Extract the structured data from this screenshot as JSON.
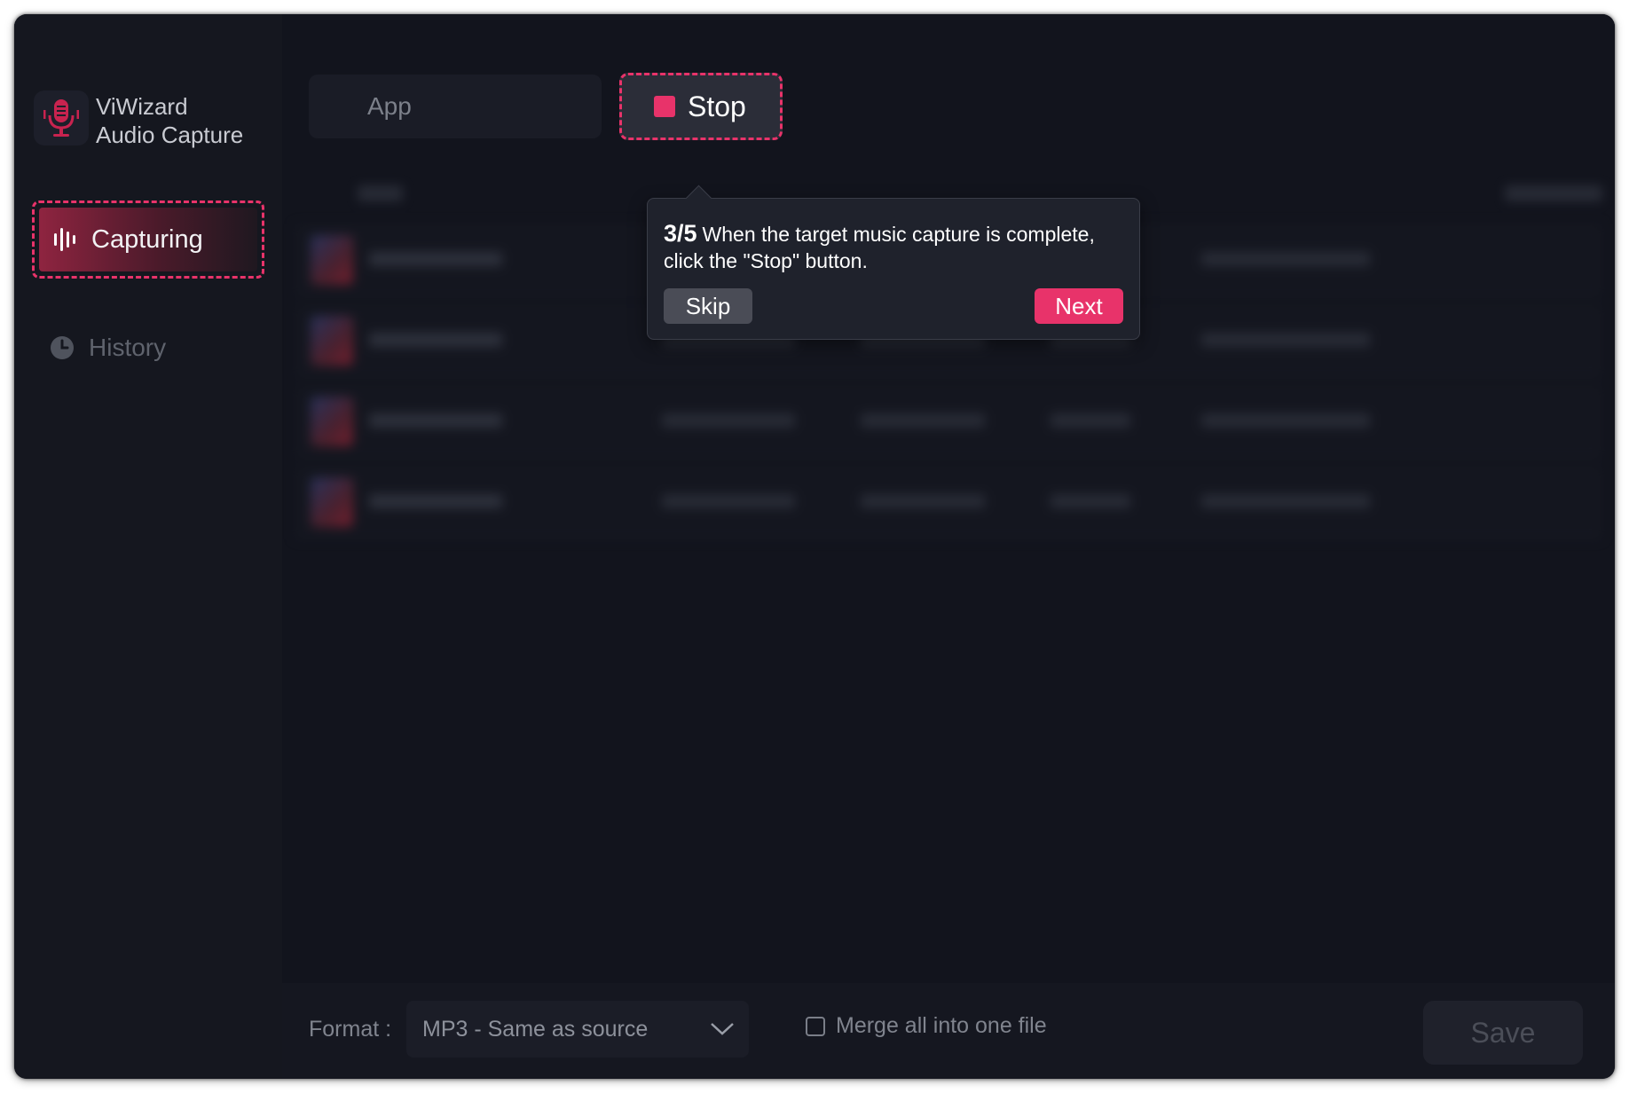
{
  "app": {
    "name_line1": "ViWizard",
    "name_line2": "Audio Capture"
  },
  "sidebar": {
    "items": [
      {
        "label": "Capturing",
        "icon": "audio-bars-icon",
        "active": true
      },
      {
        "label": "History",
        "icon": "clock-icon",
        "active": false
      }
    ]
  },
  "toolbar": {
    "app_selector": "App",
    "stop_label": "Stop"
  },
  "tooltip": {
    "step": "3/5",
    "message": "When the target music capture is complete, click the \"Stop\" button.",
    "skip_label": "Skip",
    "next_label": "Next"
  },
  "bottom_bar": {
    "format_label": "Format :",
    "format_value": "MP3 - Same as source",
    "merge_label": "Merge all into one file",
    "merge_checked": false,
    "save_label": "Save"
  },
  "colors": {
    "accent": "#e8336a",
    "background": "#12141d",
    "sidebar": "#15171f"
  }
}
